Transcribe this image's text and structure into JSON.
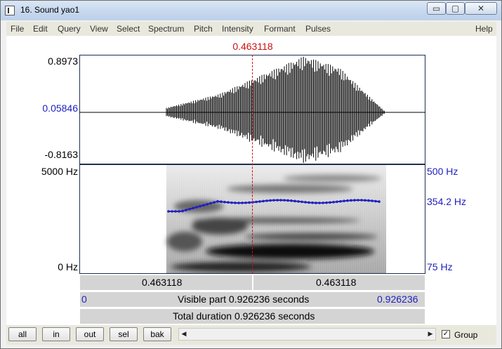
{
  "window": {
    "title": "16. Sound yao1",
    "controls": {
      "minimize": "▭",
      "maximize": "▢",
      "close": "✕"
    }
  },
  "menu": {
    "items": [
      "File",
      "Edit",
      "Query",
      "View",
      "Select",
      "Spectrum",
      "Pitch",
      "Intensity",
      "Formant",
      "Pulses"
    ],
    "help": "Help"
  },
  "cursor": {
    "time_label": "0.463118"
  },
  "waveform": {
    "y_max": "0.8973",
    "y_cursor": "0.05846",
    "y_min": "-0.8163"
  },
  "spectrogram": {
    "freq_max": "5000 Hz",
    "freq_min": "0 Hz",
    "pitch_max": "500 Hz",
    "pitch_current": "354.2 Hz",
    "pitch_min": "75 Hz"
  },
  "time_bars": {
    "left_segment": "0.463118",
    "right_segment": "0.463118",
    "visible_start": "0",
    "visible_label": "Visible part 0.926236 seconds",
    "visible_end": "0.926236",
    "total_label": "Total duration 0.926236 seconds"
  },
  "bottom": {
    "buttons": [
      "all",
      "in",
      "out",
      "sel",
      "bak"
    ],
    "scroll_left": "◀",
    "scroll_right": "▶",
    "group_label": "Group",
    "group_checked": true
  },
  "colors": {
    "cursor": "#d01010",
    "pitch": "#2020c0",
    "axis_blue": "#2020c0"
  }
}
